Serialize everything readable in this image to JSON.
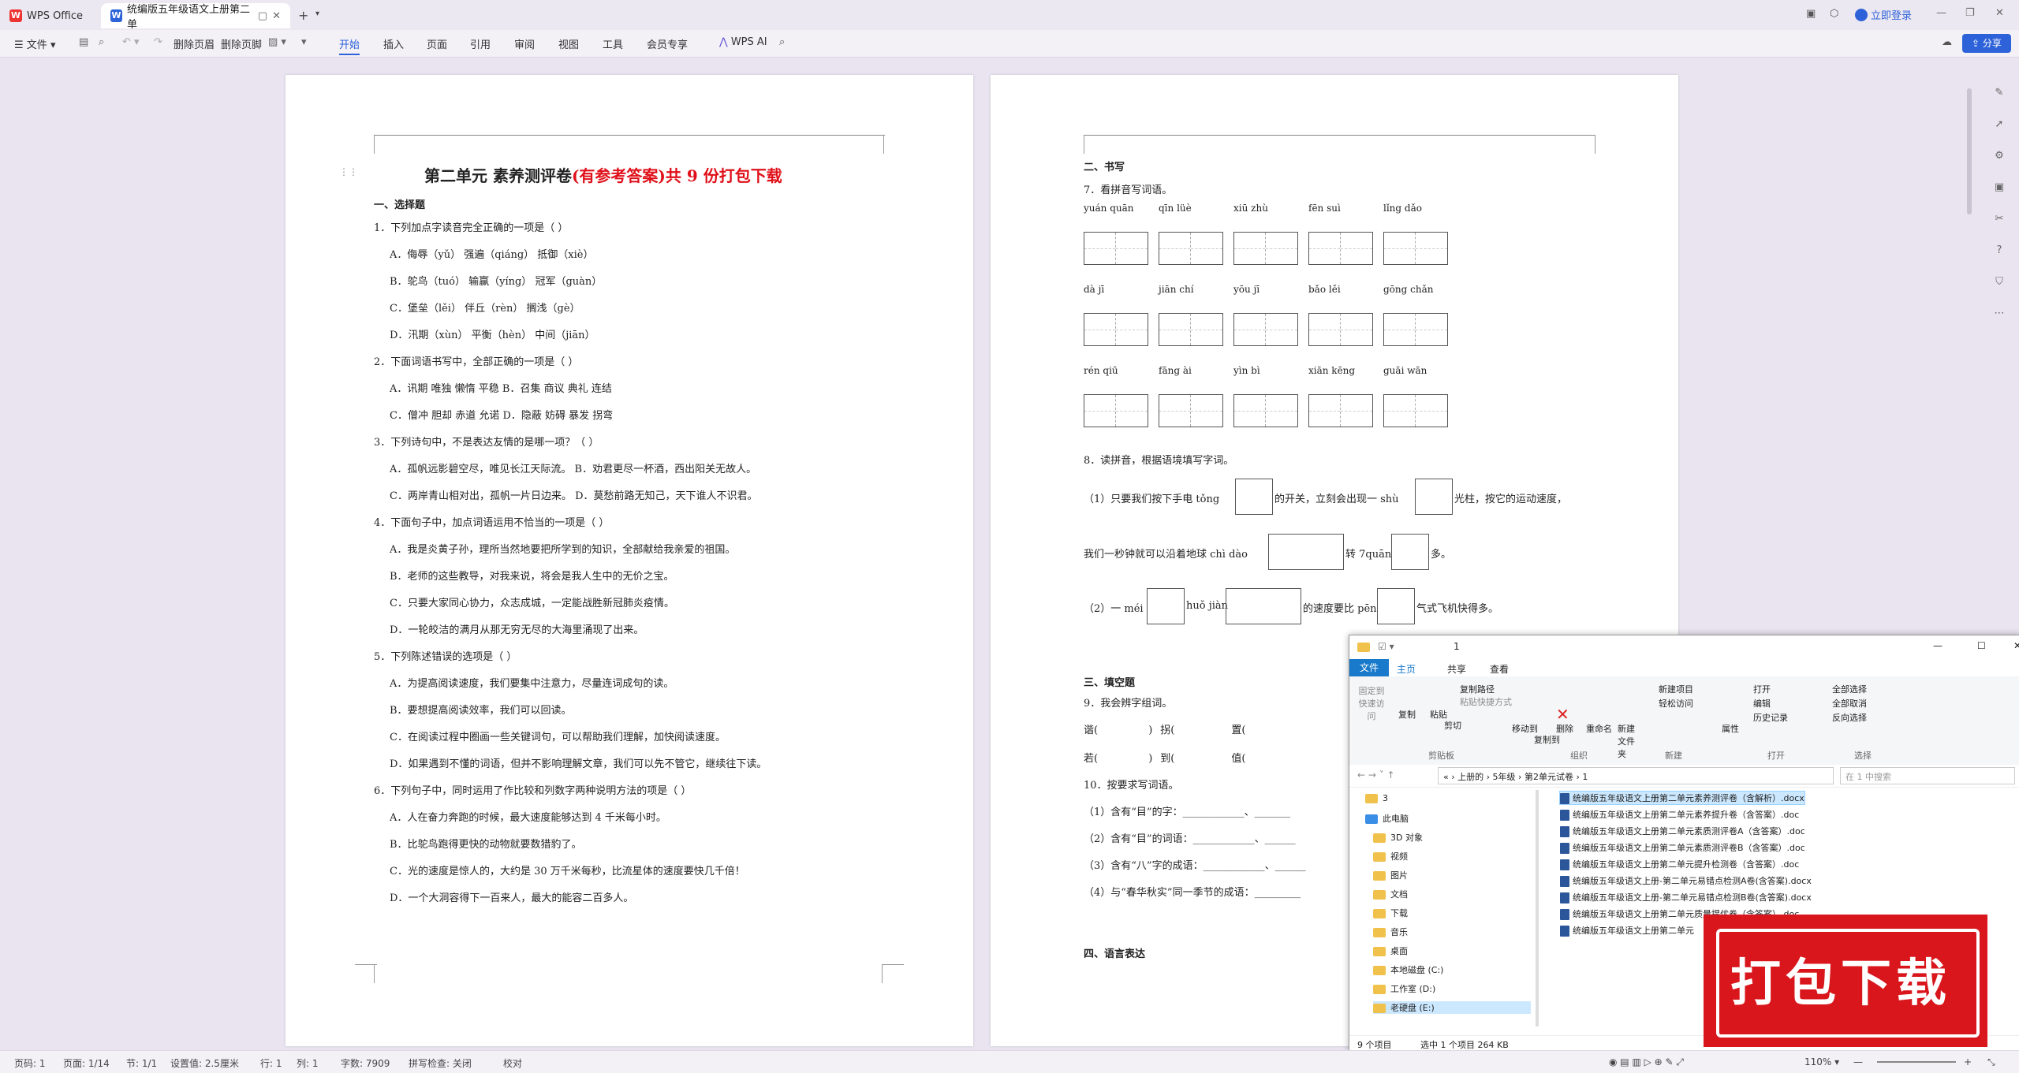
{
  "titlebar": {
    "home_tab": "WPS Office",
    "doc_tab": "统编版五年级语文上册第二单",
    "login": "立即登录"
  },
  "menubar": {
    "file": "文件",
    "delete_page": "删除页眉",
    "delete_footer": "删除页脚",
    "tabs": [
      "开始",
      "插入",
      "页面",
      "引用",
      "审阅",
      "视图",
      "工具",
      "会员专享"
    ],
    "ai": "WPS AI",
    "share": "分享"
  },
  "page1": {
    "title_black": "第二单元  素养测评卷",
    "title_red": "(有参考答案)共 9 份打包下载",
    "lines": [
      "一、选择题",
      "1．下列加点字读音完全正确的一项是（     ）",
      "A．侮辱（yǔ）     强遍（qiáng）   抵御（xiè）",
      "B．鸵鸟（tuó）    输赢（yíng）    冠军（guàn）",
      "C．堡垒（lěi）    伴丘（rèn）     搁浅（gè）",
      "D．汛期（xùn）    平衡（hèn）     中间（jiān）",
      "2．下面词语书写中，全部正确的一项是（     ）",
      "A．讯期    唯独    懒惰    平稳                  B．召集    商议    典礼    连结",
      "C．僧冲    胆却    赤道    允诺                  D．隐蔽    妨碍    暴发    拐弯",
      "3．下列诗句中，不是表达友情的是哪一项？（     ）",
      "A．孤帆远影碧空尽，唯见长江天际流。     B．劝君更尽一杯酒，西出阳关无故人。",
      "C．两岸青山相对出，孤帆一片日边来。     D．莫愁前路无知己，天下谁人不识君。",
      "4．下面句子中，加点词语运用不恰当的一项是（     ）",
      "A．我是炎黄子孙，理所当然地要把所学到的知识，全部献给我亲爱的祖国。",
      "B．老师的这些教导，对我来说，将会是我人生中的无价之宝。",
      "C．只要大家同心协力，众志成城，一定能战胜新冠肺炎疫情。",
      "D．一轮皎洁的满月从那无穷无尽的大海里涌现了出来。",
      "5．下列陈述错误的选项是（     ）",
      "A．为提高阅读速度，我们要集中注意力，尽量连词成句的读。",
      "B．要想提高阅读效率，我们可以回读。",
      "C．在阅读过程中圈画一些关键词句，可以帮助我们理解，加快阅读速度。",
      "D．如果遇到不懂的词语，但并不影响理解文章，我们可以先不管它，继续往下读。",
      "6．下列句子中，同时运用了作比较和列数字两种说明方法的项是（     ）",
      "A．人在奋力奔跑的时候，最大速度能够达到 4 千米每小时。",
      "B．比鸵鸟跑得更快的动物就要数猎豹了。",
      "C．光的速度是惊人的，大约是 30 万千米每秒，比流星体的速度要快几千倍！",
      "D．一个大洞容得下一百来人，最大的能容二百多人。"
    ]
  },
  "page2": {
    "h_write": "二、书写",
    "q7": "7．看拼音写词语。",
    "pinyin_rows": [
      [
        "yuán  quān",
        "qīn  lüè",
        "xiū  zhù",
        "fēn  suì",
        "lǐng  dǎo"
      ],
      [
        "dà  jī",
        "jiān  chí",
        "yōu  jī",
        "bǎo  lěi",
        "gōng chǎn"
      ],
      [
        "rén  qiū",
        "fāng  ài",
        "yìn  bì",
        "xiān  kēng",
        "guāi  wān"
      ]
    ],
    "q8": "8．读拼音，根据语境填写字词。",
    "q8_1a": "（1）只要我们按下手电 tǒng",
    "q8_1b": "的开关，立刻会出现一 shù",
    "q8_1c": "光柱，按它的运动速度，",
    "q8_1d": "我们一秒钟就可以沿着地球 chì dào",
    "q8_1e": "转 7quān",
    "q8_1f": "多。",
    "q8_2a": "（2）一 méi",
    "q8_2b": "huǒ jiàn",
    "q8_2c": "的速度要比 pēn",
    "q8_2d": "气式飞机快得多。",
    "h_fill": "三、填空题",
    "q9": "9．我会辨字组词。",
    "q9_row1": [
      "谐(",
      "          )",
      "拐(",
      "          )",
      "置("
    ],
    "q9_row2": [
      "若(",
      "          )",
      "到(",
      "          )",
      "值("
    ],
    "q10": "10．按要求写词语。",
    "q10_items": [
      "（1）含有“目”的字：____________、_______",
      "（2）含有“目”的词语：____________、______",
      "（3）含有“八”字的成语：____________、______",
      "（4）与“春华秋实”同一季节的成语：_________"
    ],
    "h_lang": "四、语言表达"
  },
  "explorer": {
    "title": "1",
    "ribbon_tabs": [
      "文件",
      "主页",
      "共享",
      "查看"
    ],
    "groups": {
      "clipboard": "剪贴板",
      "organize": "组织",
      "new": "新建",
      "open": "打开",
      "select": "选择"
    },
    "buttons": [
      "固定到快速访问",
      "复制",
      "粘贴",
      "复制路径",
      "粘贴快捷方式",
      "剪切",
      "移动到",
      "复制到",
      "删除",
      "重命名",
      "新建文件夹",
      "新建项目",
      "轻松访问",
      "属性",
      "打开",
      "编辑",
      "历史记录",
      "全部选择",
      "全部取消",
      "反向选择"
    ],
    "path": [
      "«",
      "上册的",
      "5年级",
      "第2单元试卷",
      "1"
    ],
    "search_placeholder": "在 1 中搜索",
    "nav": [
      "3",
      "此电脑",
      "3D 对象",
      "视频",
      "图片",
      "文档",
      "下载",
      "音乐",
      "桌面",
      "本地磁盘 (C:)",
      "工作室 (D:)",
      "老硬盘 (E:)"
    ],
    "files": [
      "统编版五年级语文上册第二单元素养测评卷（含解析）.docx",
      "统编版五年级语文上册第二单元素养提升卷（含答案）.doc",
      "统编版五年级语文上册第二单元素质测评卷A（含答案）.doc",
      "统编版五年级语文上册第二单元素质测评卷B（含答案）.doc",
      "统编版五年级语文上册第二单元提升检测卷（含答案）.doc",
      "统编版五年级语文上册-第二单元易错点检测A卷(含答案).docx",
      "统编版五年级语文上册-第二单元易错点检测B卷(含答案).docx",
      "统编版五年级语文上册第二单元质量提优卷（含答案）.doc",
      "统编版五年级语文上册第二单元"
    ],
    "status": [
      "9 个项目",
      "选中 1 个项目  264 KB"
    ]
  },
  "stamp": "打包下载",
  "statusbar": {
    "items": [
      "页码: 1",
      "页面: 1/14",
      "节: 1/1",
      "设置值: 2.5厘米",
      "行: 1",
      "列: 1",
      "字数: 7909",
      "拼写检查: 关闭",
      "校对"
    ],
    "zoom": "110%"
  }
}
